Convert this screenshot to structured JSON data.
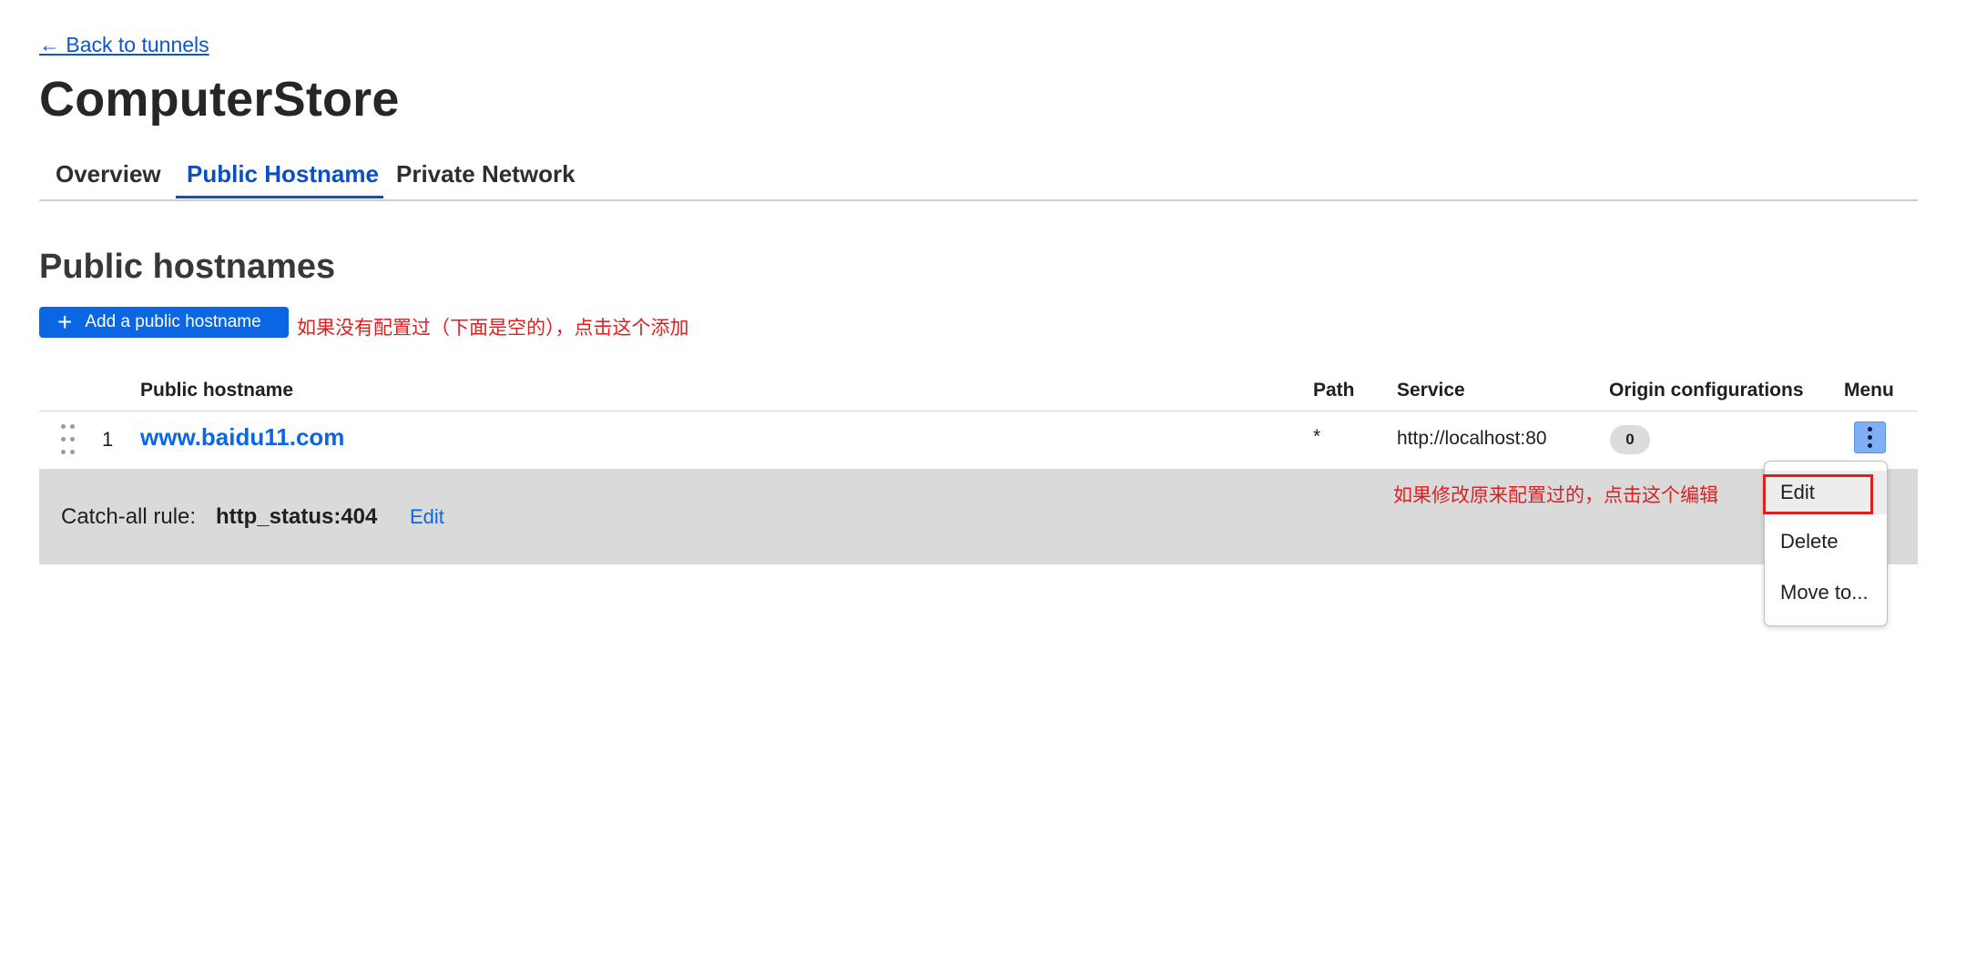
{
  "nav": {
    "back_link": "← Back to tunnels"
  },
  "page_title": "ComputerStore",
  "tabs": [
    {
      "label": "Overview",
      "active": false
    },
    {
      "label": "Public Hostname",
      "active": true
    },
    {
      "label": "Private Network",
      "active": false
    }
  ],
  "section": {
    "title": "Public hostnames",
    "add_button": "Add a public hostname"
  },
  "annotations": {
    "add_hint": "如果没有配置过（下面是空的），点击这个添加",
    "edit_hint": "如果修改原来配置过的，点击这个编辑"
  },
  "table": {
    "headers": [
      "Public hostname",
      "Path",
      "Service",
      "Origin configurations",
      "Menu"
    ],
    "rows": [
      {
        "index": "1",
        "hostname": "www.baidu11.com",
        "path": "*",
        "service": "http://localhost:80",
        "origin_count": "0"
      }
    ]
  },
  "catch_all": {
    "label": "Catch-all rule:",
    "value": "http_status:404",
    "edit_label": "Edit"
  },
  "row_menu": {
    "items": [
      "Edit",
      "Delete",
      "Move to..."
    ],
    "hovered": "Edit"
  },
  "colors": {
    "link": "#0b66e4",
    "active_tab": "#0b4fc4",
    "annotation": "#e02020",
    "catch_all_bg": "#dadada",
    "menu_button": "#7fb0f5"
  }
}
